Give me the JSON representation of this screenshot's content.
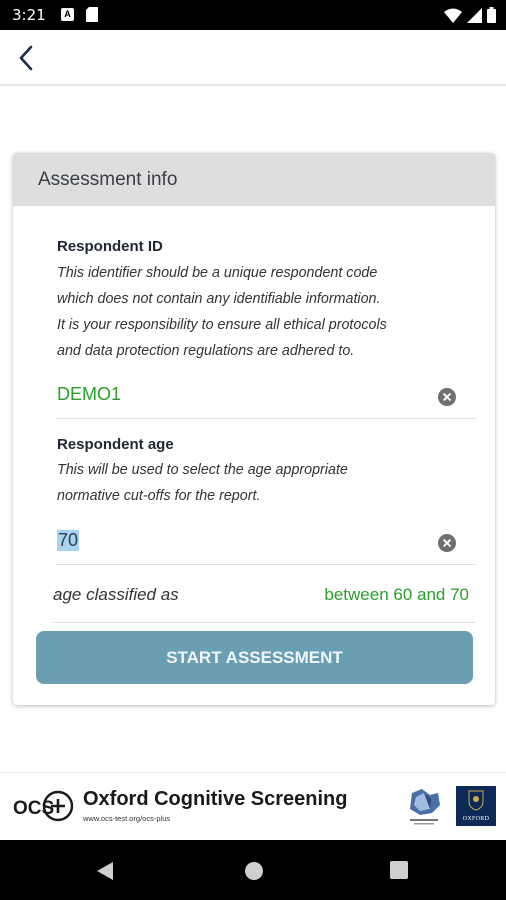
{
  "status_bar": {
    "time": "3:21",
    "notification_letter": "A"
  },
  "card": {
    "header": "Assessment info",
    "respondent_id": {
      "title": "Respondent ID",
      "description": [
        "This identifier should be a unique respondent code",
        "which does not contain any identifiable information.",
        "It is your responsibility to ensure all ethical protocols",
        "and data protection regulations are adhered to."
      ],
      "value": "DEMO1"
    },
    "respondent_age": {
      "title": "Respondent age",
      "description": [
        "This will be used to select the age appropriate",
        "normative cut-offs for the report."
      ],
      "value": "70"
    },
    "classification": {
      "label": "age classified as",
      "value": "between 60 and 70"
    },
    "start_button": "START ASSESSMENT"
  },
  "footer": {
    "logo_text": "OCS+",
    "title": "Oxford Cognitive Screening",
    "url": "www.ocs-test.org/ocs-plus",
    "oxford_logo_text": "OXFORD"
  },
  "colors": {
    "accent_green": "#2aa02a",
    "button": "#6a9fb3",
    "header_gray": "#dedede"
  },
  "icons": [
    "back-arrow-icon",
    "clear-icon",
    "back-triangle-icon",
    "home-circle-icon",
    "recents-square-icon"
  ]
}
